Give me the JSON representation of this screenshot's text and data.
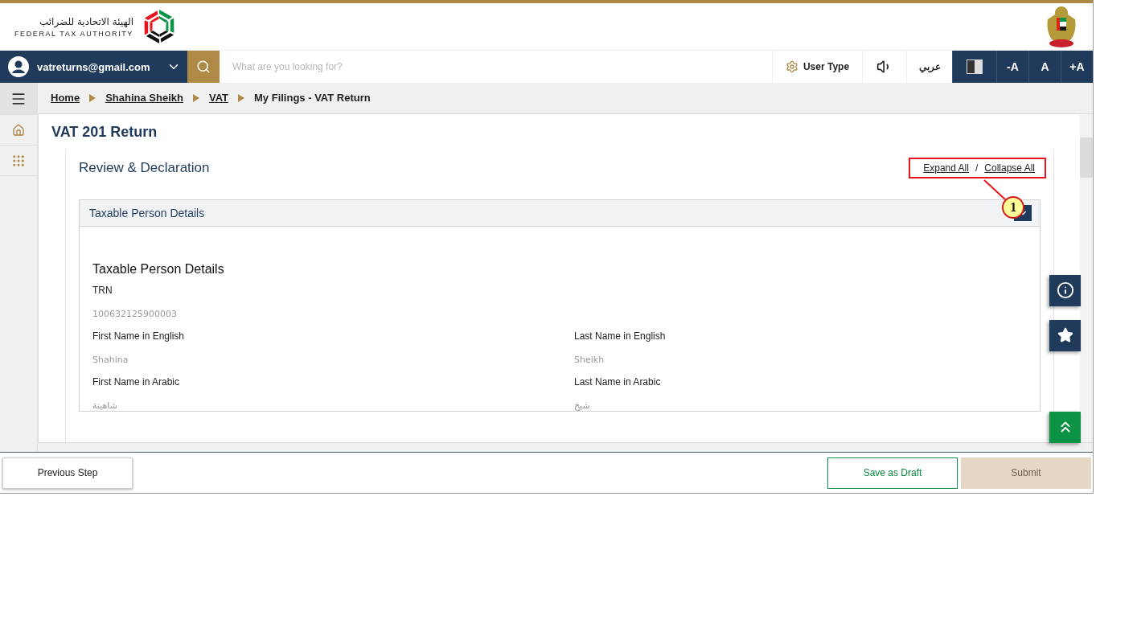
{
  "header": {
    "logo_arabic": "الهيئة الاتحادية للضرائب",
    "logo_english": "FEDERAL TAX AUTHORITY"
  },
  "navbar": {
    "user_email": "vatreturns@gmail.com",
    "search": {
      "placeholder": "What are you looking for?"
    },
    "user_type": "User Type",
    "language": "عربي",
    "font_sizes": [
      "-A",
      "A",
      "+A"
    ]
  },
  "breadcrumb": [
    {
      "label": "Home",
      "link": true
    },
    {
      "label": "Shahina Sheikh",
      "link": true
    },
    {
      "label": "VAT",
      "link": true
    },
    {
      "label": "My Filings - VAT Return",
      "link": false
    }
  ],
  "page_title": "VAT 201 Return",
  "section": {
    "title": "Review & Declaration",
    "expand_all": "Expand All",
    "separator": "/",
    "collapse_all": "Collapse All",
    "annotation": "1"
  },
  "accordion": {
    "title": "Taxable Person Details",
    "expanded": true,
    "heading": "Taxable Person Details",
    "fields": [
      {
        "label": "TRN",
        "value": "100632125900003",
        "kind": "full"
      },
      {
        "label": "First Name in English",
        "value": "Shahina",
        "kind": "half"
      },
      {
        "label": "Last Name in English",
        "value": "Sheikh",
        "kind": "half"
      },
      {
        "label": "First Name in Arabic",
        "value": "شاهينة",
        "kind": "half"
      },
      {
        "label": "Last Name in Arabic",
        "value": "شيخ",
        "kind": "half"
      }
    ]
  },
  "footer": {
    "previous": "Previous Step",
    "save": "Save as Draft",
    "submit": {
      "label": "Submit",
      "disabled": true
    }
  }
}
